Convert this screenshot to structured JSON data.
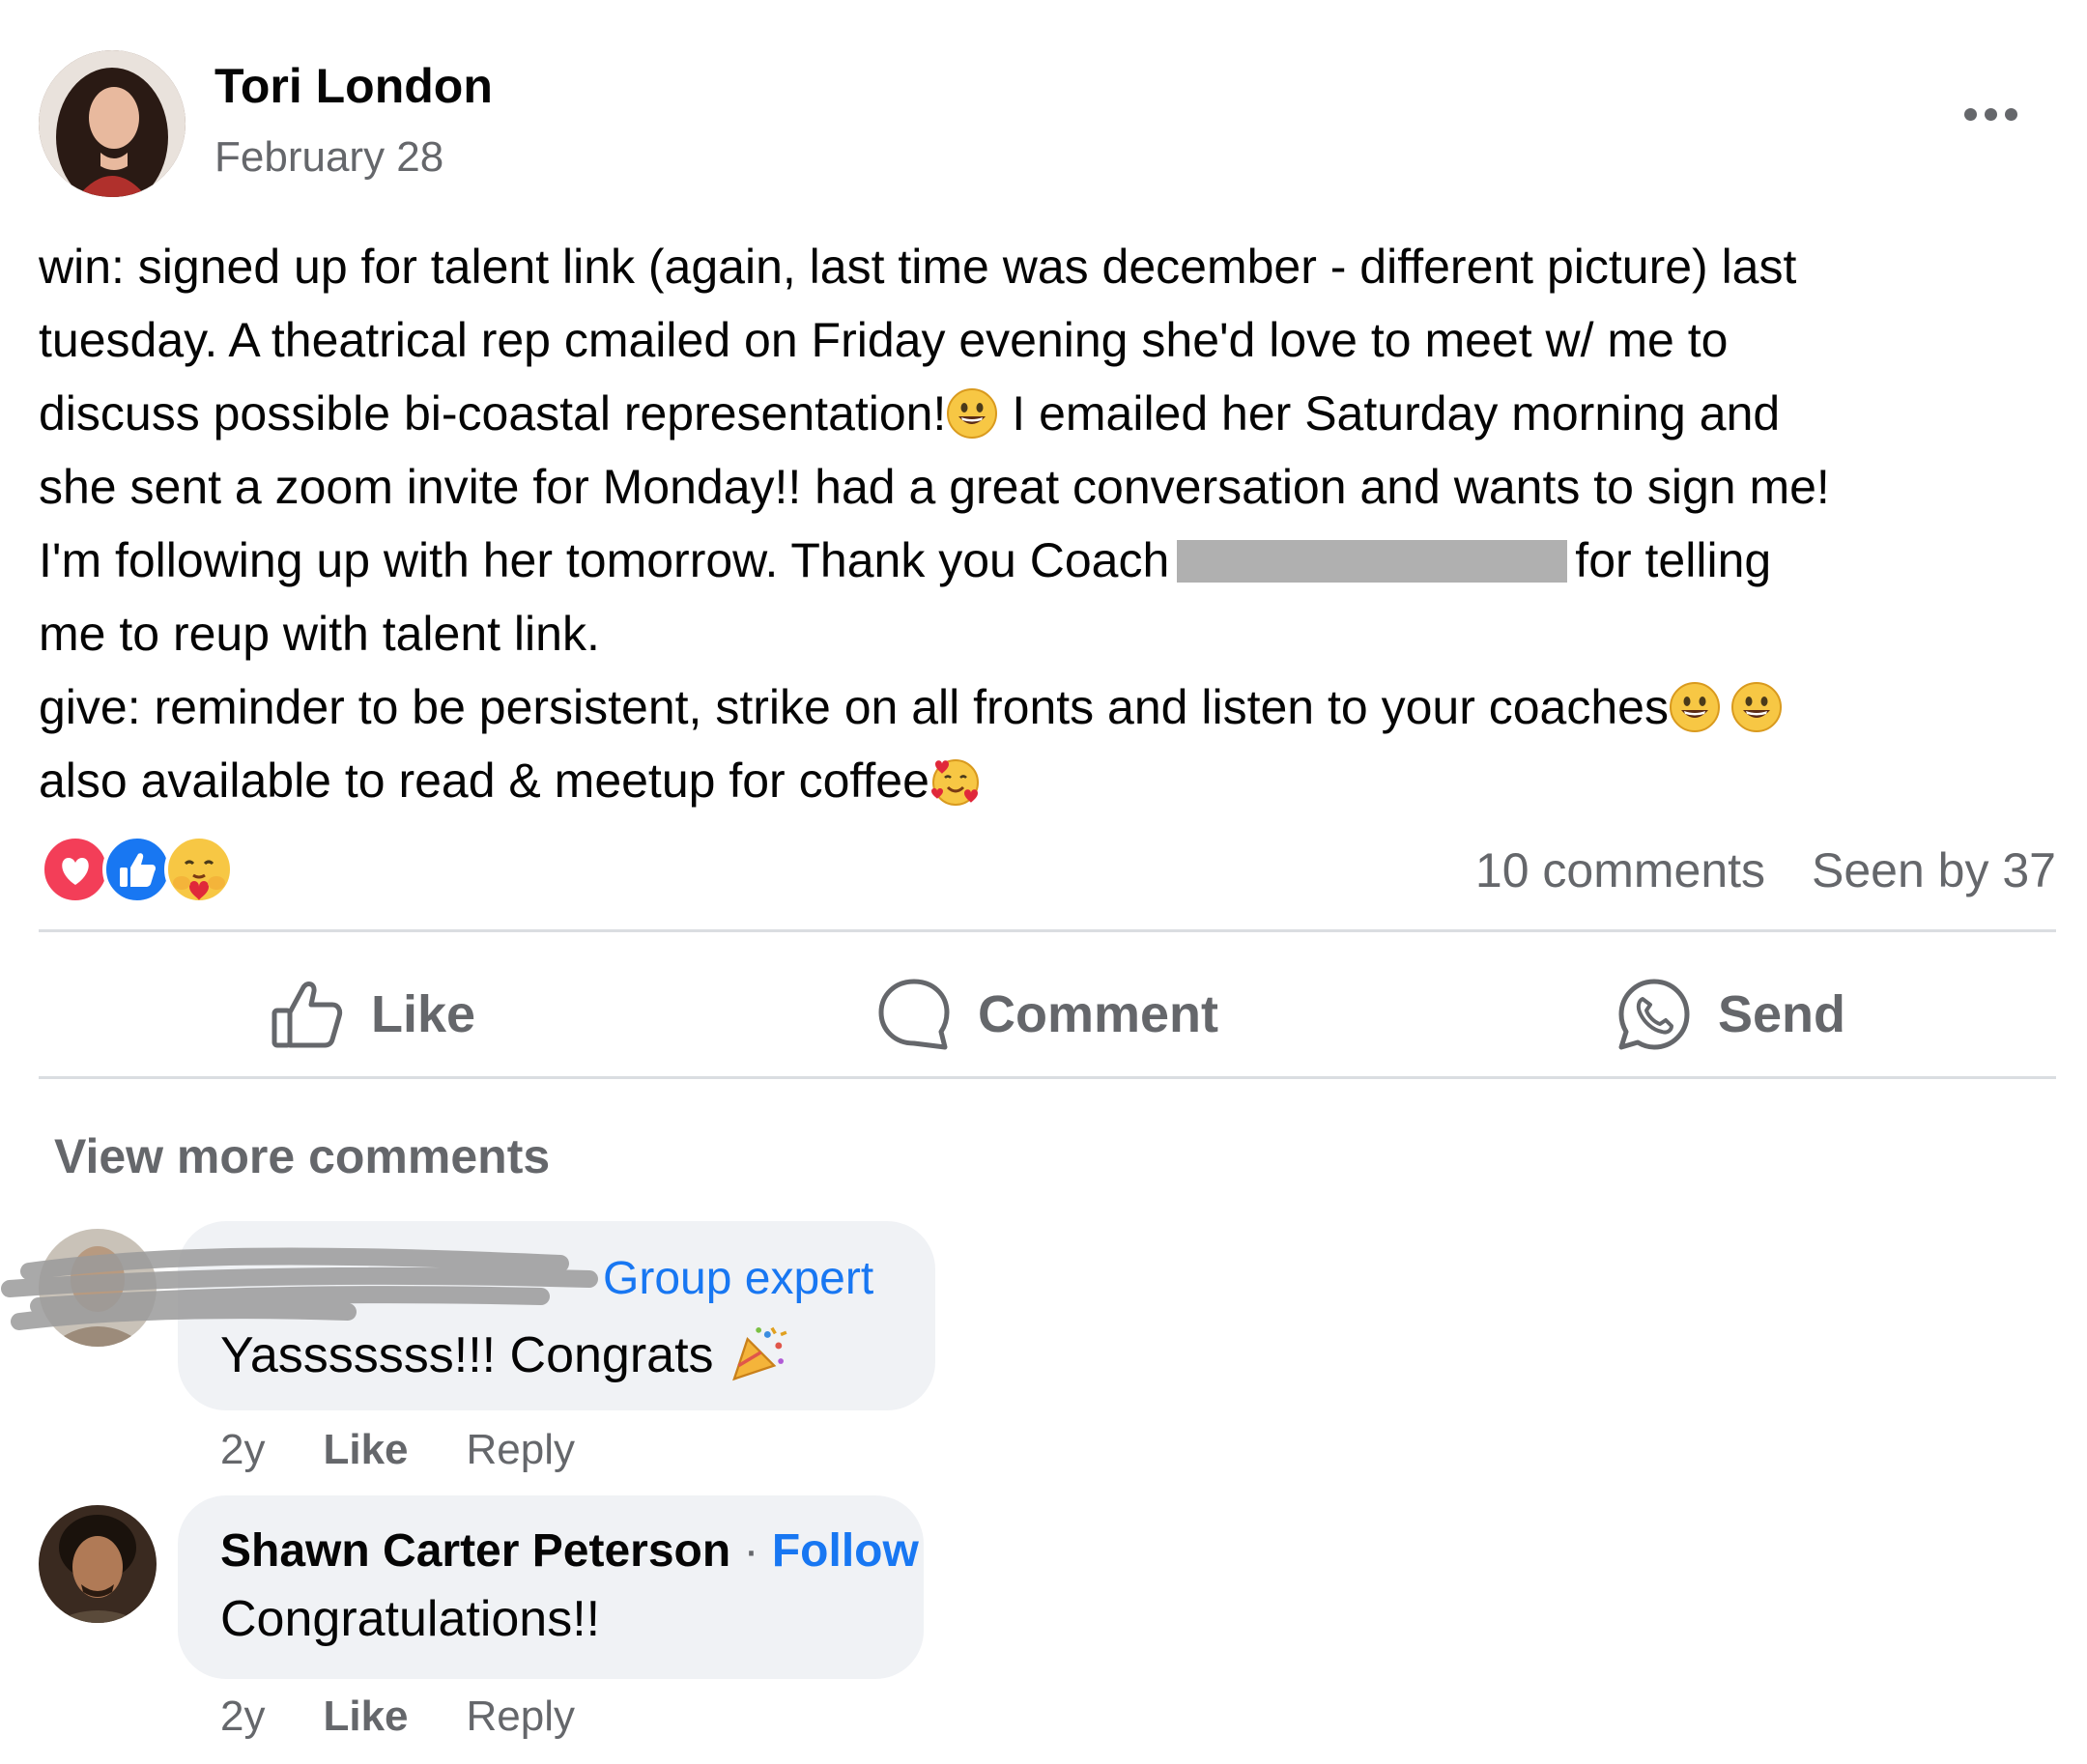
{
  "post": {
    "author": "Tori London",
    "date": "February 28",
    "lines": [
      "win:  signed up for talent link (again, last time was december - different picture) last",
      "tuesday. A theatrical rep cmailed on Friday evening she'd love to meet w/ me to",
      "discuss possible bi-coastal representation!",
      " I emailed her Saturday morning and",
      "she sent a zoom invite for Monday!! had a great conversation and wants to sign me!",
      "I'm following up with her tomorrow.  Thank you Coach",
      "for telling",
      "me to reup with talent link.",
      "give: reminder to be persistent, strike on all fronts and listen to your coaches",
      "also available to read & meetup for coffee"
    ],
    "comments_count": "10 comments",
    "seen_by": "Seen by 37"
  },
  "actions": {
    "like": "Like",
    "comment": "Comment",
    "send": "Send"
  },
  "view_more": "View more comments",
  "comments": [
    {
      "badge": "Group expert",
      "text": "Yasssssss!!! Congrats",
      "age": "2y",
      "like": "Like",
      "reply": "Reply"
    },
    {
      "name": "Shawn Carter Peterson",
      "separator": "·",
      "follow": "Follow",
      "text": "Congratulations!!",
      "age": "2y",
      "like": "Like",
      "reply": "Reply"
    }
  ],
  "colors": {
    "link_blue": "#1877f2",
    "muted": "#65676b",
    "bubble": "#f0f2f5",
    "love": "#f33e58",
    "like": "#1877f2"
  }
}
